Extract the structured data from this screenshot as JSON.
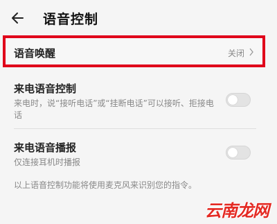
{
  "header": {
    "title": "语音控制",
    "back_icon": "arrow-left-icon"
  },
  "voice_wakeup": {
    "label": "语音唤醒",
    "value": "关闭",
    "chevron_icon": "chevron-right-icon",
    "highlight_color": "#e0001a"
  },
  "incoming_call_voice_control": {
    "label": "来电语音控制",
    "description": "来电时，说“接听电话”或“挂断电话”可以接听、拒接电话",
    "enabled": false
  },
  "incoming_call_announcement": {
    "label": "来电语音播报",
    "description": "仅连接耳机时播报",
    "enabled": false
  },
  "footer_note": "以上语音控制功能将使用麦克风来识别您的指令。",
  "watermark": "云南龙网"
}
